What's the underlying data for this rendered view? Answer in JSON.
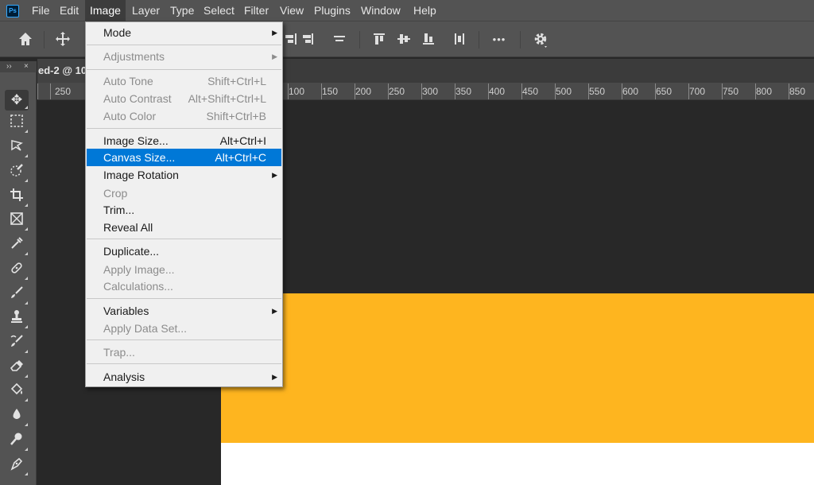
{
  "app": {
    "logo": "Ps"
  },
  "menubar": {
    "items": [
      "File",
      "Edit",
      "Image",
      "Layer",
      "Type",
      "Select",
      "Filter",
      "View",
      "Plugins",
      "Window",
      "Help"
    ],
    "active": "Image"
  },
  "options_bar": {
    "icons": [
      "home-icon",
      "move-icon",
      "align-top-icon",
      "align-vertical-center-icon",
      "align-bottom-icon",
      "distribute-icon",
      "more-icon",
      "settings-icon"
    ],
    "more_label": "•••"
  },
  "toolbar": {
    "header_left": "››",
    "header_right": "×",
    "tools": [
      "move-tool-icon",
      "marquee-tool-icon",
      "lasso-tool-icon",
      "quick-selection-tool-icon",
      "crop-tool-icon",
      "frame-tool-icon",
      "eyedropper-tool-icon",
      "healing-brush-tool-icon",
      "brush-tool-icon",
      "clone-stamp-tool-icon",
      "history-brush-tool-icon",
      "eraser-tool-icon",
      "paint-bucket-tool-icon",
      "blur-tool-icon",
      "dodge-tool-icon",
      "pen-tool-icon"
    ]
  },
  "document": {
    "tab_title": "ed-2 @ 10"
  },
  "ruler": {
    "labels": [
      "250",
      "100",
      "150",
      "200",
      "250",
      "300",
      "350",
      "400",
      "450",
      "500",
      "550",
      "600",
      "650",
      "700",
      "750",
      "800",
      "850"
    ]
  },
  "canvas": {
    "colors": {
      "background": "#282828",
      "orange": "#feb51f",
      "white": "#ffffff"
    }
  },
  "image_menu": {
    "items": [
      {
        "label": "Mode",
        "submenu": true,
        "enabled": true
      },
      {
        "label": "Adjustments",
        "submenu": true,
        "enabled": false
      },
      {
        "label": "Auto Tone",
        "shortcut": "Shift+Ctrl+L",
        "enabled": false
      },
      {
        "label": "Auto Contrast",
        "shortcut": "Alt+Shift+Ctrl+L",
        "enabled": false
      },
      {
        "label": "Auto Color",
        "shortcut": "Shift+Ctrl+B",
        "enabled": false
      },
      {
        "label": "Image Size...",
        "shortcut": "Alt+Ctrl+I",
        "enabled": true
      },
      {
        "label": "Canvas Size...",
        "shortcut": "Alt+Ctrl+C",
        "enabled": true,
        "highlighted": true
      },
      {
        "label": "Image Rotation",
        "submenu": true,
        "enabled": true
      },
      {
        "label": "Crop",
        "enabled": false
      },
      {
        "label": "Trim...",
        "enabled": true
      },
      {
        "label": "Reveal All",
        "enabled": true
      },
      {
        "label": "Duplicate...",
        "enabled": true
      },
      {
        "label": "Apply Image...",
        "enabled": false
      },
      {
        "label": "Calculations...",
        "enabled": false
      },
      {
        "label": "Variables",
        "submenu": true,
        "enabled": true
      },
      {
        "label": "Apply Data Set...",
        "enabled": false
      },
      {
        "label": "Trap...",
        "enabled": false
      },
      {
        "label": "Analysis",
        "submenu": true,
        "enabled": true
      }
    ],
    "highlight_color": "#0078d7"
  }
}
